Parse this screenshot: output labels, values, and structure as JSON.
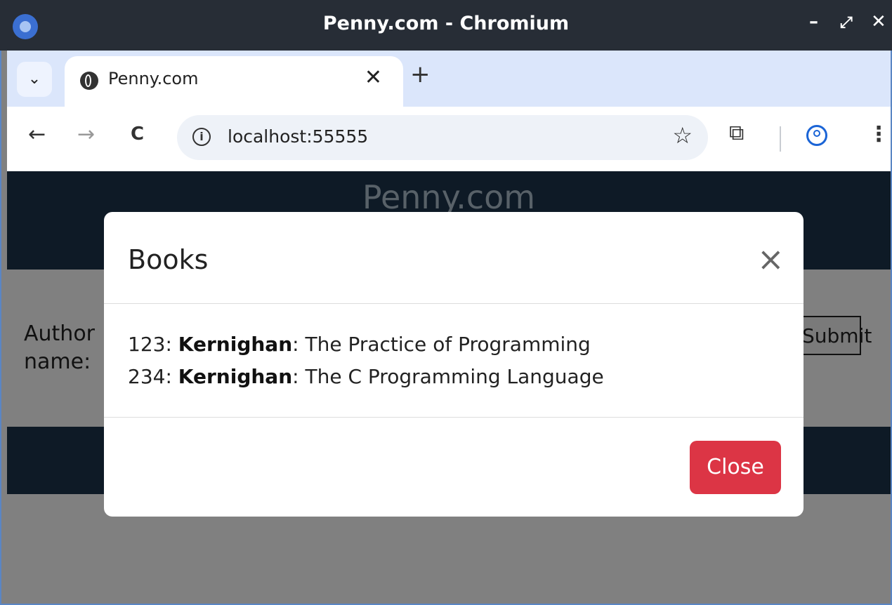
{
  "window": {
    "title": "Penny.com - Chromium",
    "minimize": "–",
    "maximize": "⤢",
    "close": "✕"
  },
  "tabs": {
    "dropdown_icon": "⌄",
    "active_title": "Penny.com",
    "close": "✕",
    "new_tab": "+"
  },
  "toolbar": {
    "back": "←",
    "forward": "→",
    "reload": "C",
    "info": "i",
    "url": "localhost:55555",
    "star": "☆",
    "extensions": "⧉",
    "menu": "⋮"
  },
  "page": {
    "site_title": "Penny.com",
    "form_label_line1": "Author",
    "form_label_line2": "name:",
    "submit_label": "Submit"
  },
  "modal": {
    "title": "Books",
    "close_x": "×",
    "books": [
      {
        "id": "123:",
        "author": "Kernighan",
        "title": ": The Practice of Programming"
      },
      {
        "id": "234:",
        "author": "Kernighan",
        "title": ": The C Programming Language"
      }
    ],
    "close_button": "Close"
  },
  "colors": {
    "header_bg": "#0e1a26",
    "overlay": "#808080",
    "close_btn": "#dc3545",
    "accent": "#1a64d6"
  }
}
